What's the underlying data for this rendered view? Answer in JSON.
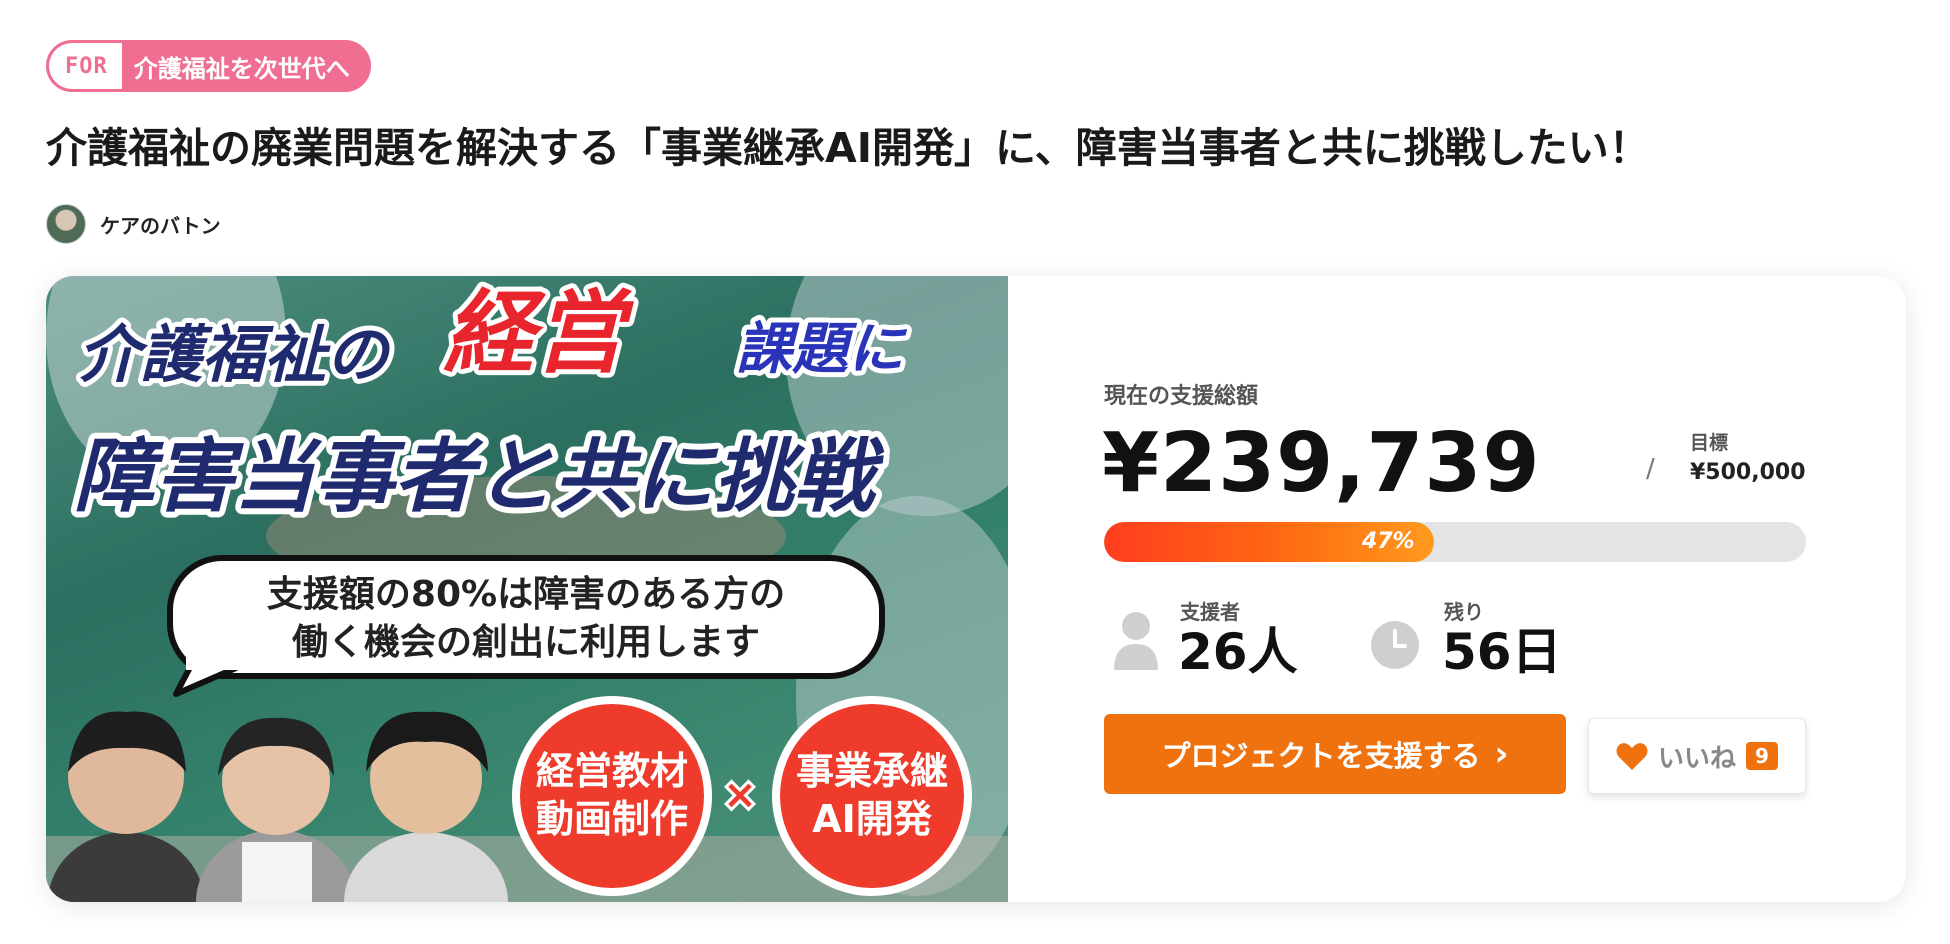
{
  "tag": {
    "prefix": "FOR",
    "text": "介護福祉を次世代へ"
  },
  "project": {
    "title": "介護福祉の廃業問題を解決する「事業継承AI開発」に、障害当事者と共に挑戦したい！",
    "owner": "ケアのバトン"
  },
  "hero": {
    "line1_a": "介護福祉の",
    "line1_b": "経営",
    "line1_c": "課題に",
    "line2": "障害当事者と共に挑戦",
    "bubble_line1": "支援額の80%は障害のある方の",
    "bubble_line2": "働く機会の創出に利用します",
    "circle1_line1": "経営教材",
    "circle1_line2": "動画制作",
    "times": "×",
    "circle2_line1": "事業承継",
    "circle2_line2": "AI開発"
  },
  "funding": {
    "label": "現在の支援総額",
    "amount": "¥239,739",
    "slash": "/",
    "goal_label": "目標",
    "goal": "¥500,000",
    "progress_percent": 47,
    "progress_text": "47%"
  },
  "stats": {
    "supporters_label": "支援者",
    "supporters_value": "26人",
    "remaining_label": "残り",
    "remaining_value": "56日"
  },
  "actions": {
    "support_label": "プロジェクトを支援する",
    "support_chevron": "›",
    "like_label": "いいね",
    "like_count": "9"
  },
  "colors": {
    "tag_pink": "#ef6e92",
    "accent_orange": "#f0720f",
    "hero_red": "#e8252d",
    "hero_navy": "#1f2b6e"
  }
}
